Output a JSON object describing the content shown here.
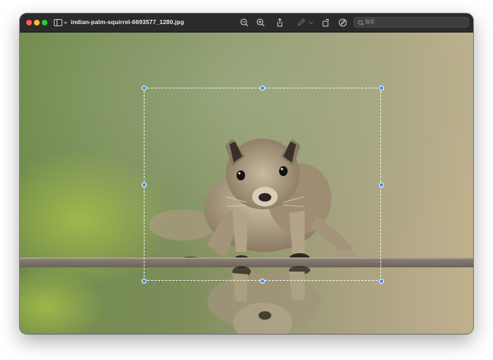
{
  "window": {
    "title": "indian-palm-squirrel-6693577_1280.jpg"
  },
  "toolbar": {
    "buttons": [
      {
        "name": "zoom-out-icon"
      },
      {
        "name": "zoom-in-icon"
      },
      {
        "name": "share-icon"
      },
      {
        "name": "markup-pen-icon"
      },
      {
        "name": "chevron-down-icon"
      },
      {
        "name": "rotate-icon"
      },
      {
        "name": "markup-icon"
      }
    ],
    "search": {
      "placeholder": "搜索"
    }
  },
  "image": {
    "subject": "Indian palm squirrel on a reflective surface",
    "colors": {
      "background_green": "#6f8a4a",
      "background_beige": "#b8a98a",
      "selection_handle": "#3d8cf0"
    }
  }
}
